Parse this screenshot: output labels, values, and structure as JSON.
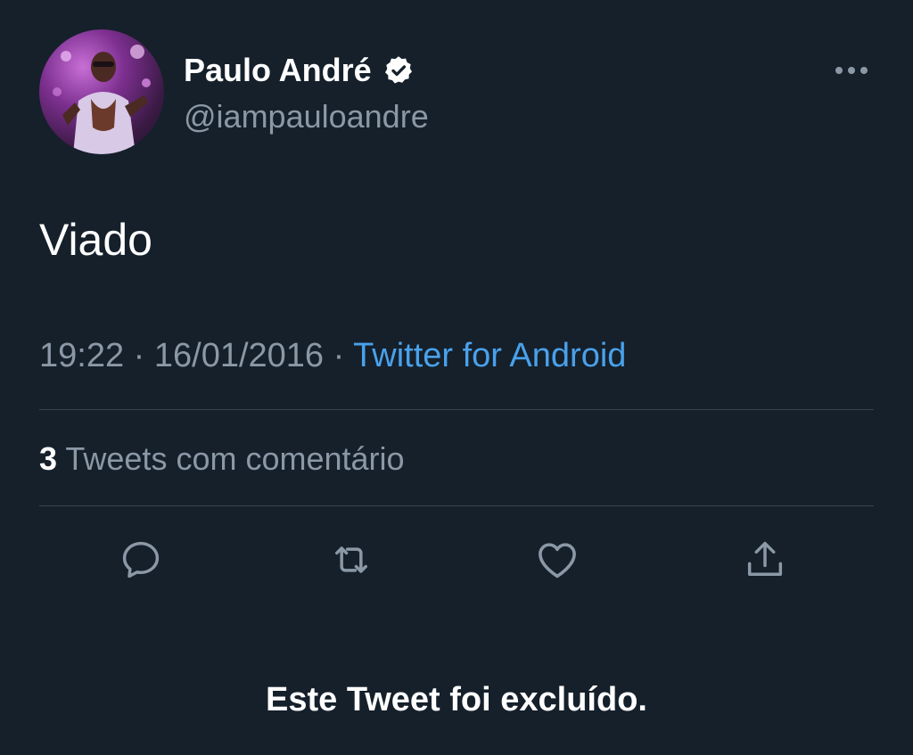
{
  "profile": {
    "display_name": "Paulo André",
    "handle": "@iampauloandre",
    "avatar_icon": "avatar-photo",
    "verified_icon": "verified-badge-icon"
  },
  "header": {
    "more_icon": "more-options-icon"
  },
  "tweet": {
    "text": "Viado",
    "time": "19:22",
    "separator": "·",
    "date": "16/01/2016",
    "source": "Twitter for Android"
  },
  "stats": {
    "quote_count": "3",
    "quote_label": "Tweets com comentário"
  },
  "actions": [
    {
      "name": "reply",
      "icon": "reply-icon"
    },
    {
      "name": "retweet",
      "icon": "retweet-icon"
    },
    {
      "name": "like",
      "icon": "heart-icon"
    },
    {
      "name": "share",
      "icon": "share-icon"
    }
  ],
  "notice": {
    "deleted_text": "Este Tweet foi excluído."
  },
  "colors": {
    "background": "#15202b",
    "text_primary": "#ffffff",
    "text_secondary": "#8b98a5",
    "link": "#4aa1eb",
    "divider": "#38444d"
  }
}
